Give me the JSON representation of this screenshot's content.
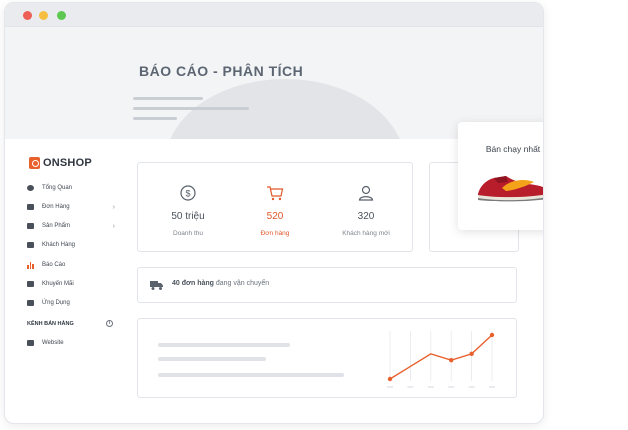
{
  "banner": {
    "title": "BÁO CÁO - PHÂN TÍCH"
  },
  "brand": {
    "name": "ONSHOP",
    "accent": "#e8602c"
  },
  "sidebar": {
    "items": [
      {
        "label": "Tổng Quan",
        "icon": "pie-icon"
      },
      {
        "label": "Đơn Hàng",
        "icon": "cart-icon",
        "chevron": "›"
      },
      {
        "label": "Sản Phẩm",
        "icon": "tag-icon",
        "chevron": "›"
      },
      {
        "label": "Khách Hàng",
        "icon": "contacts-icon"
      },
      {
        "label": "Báo Cáo",
        "icon": "bar-chart-icon",
        "active": true
      },
      {
        "label": "Khuyến Mãi",
        "icon": "gift-icon"
      },
      {
        "label": "Ứng Dụng",
        "icon": "apps-icon"
      }
    ],
    "section_label": "KÊNH BÁN HÀNG",
    "section_info": "i",
    "channels": [
      {
        "label": "Website",
        "icon": "store-icon"
      }
    ]
  },
  "stats": [
    {
      "value": "50 triệu",
      "label": "Doanh thu",
      "icon": "dollar-icon"
    },
    {
      "value": "520",
      "label": "Đơn hàng",
      "icon": "cart-icon",
      "highlight": true
    },
    {
      "value": "320",
      "label": "Khách hàng mới",
      "icon": "user-icon"
    }
  ],
  "shipping": {
    "count": "40 đơn hàng",
    "text": " đang vận chuyển",
    "icon": "truck-icon"
  },
  "mini_chart": {
    "type": "line",
    "values": [
      1,
      3,
      5,
      4,
      5,
      8
    ],
    "color": "#e8602c"
  },
  "popup": {
    "title": "Bán chạy nhất",
    "image": "sneaker-icon"
  }
}
